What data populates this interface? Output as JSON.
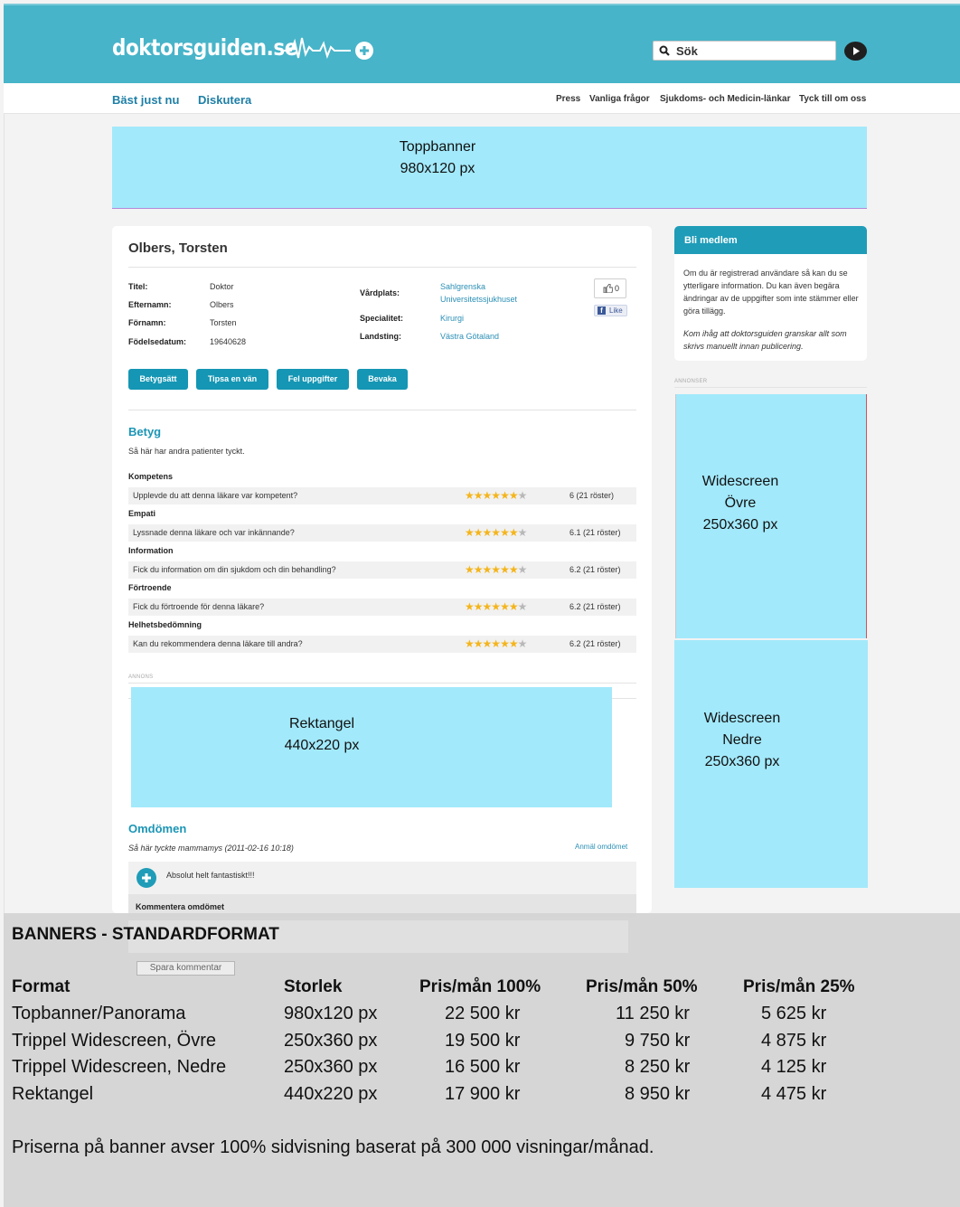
{
  "header": {
    "logo_text": "doktorsguiden.se",
    "search_placeholder": "Sök"
  },
  "subnav": {
    "left": [
      "Bäst just nu",
      "Diskutera"
    ],
    "right": [
      "Press",
      "Vanliga frågor",
      "Sjukdoms- och Medicin-länkar",
      "Tyck till om oss"
    ]
  },
  "banners": {
    "top": {
      "line1": "Toppbanner",
      "line2": "980x120 px"
    },
    "wide_top": {
      "line1": "Widescreen",
      "line2": "Övre",
      "line3": "250x360 px"
    },
    "wide_bottom": {
      "line1": "Widescreen",
      "line2": "Nedre",
      "line3": "250x360 px"
    },
    "rect": {
      "line1": "Rektangel",
      "line2": "440x220 px"
    }
  },
  "profile": {
    "name": "Olbers, Torsten",
    "fields": {
      "titel_label": "Titel:",
      "titel": "Doktor",
      "efternamn_label": "Efternamn:",
      "efternamn": "Olbers",
      "fornamn_label": "Förnamn:",
      "fornamn": "Torsten",
      "fodelsedatum_label": "Födelsedatum:",
      "fodelsedatum": "19640628",
      "vardplats_label": "Vårdplats:",
      "vardplats_1": "Sahlgrenska",
      "vardplats_2": "Universitetssjukhuset",
      "specialitet_label": "Specialitet:",
      "specialitet": "Kirurgi",
      "landsting_label": "Landsting:",
      "landsting": "Västra Götaland"
    },
    "like_count": "0",
    "like_label": "Like",
    "buttons": [
      "Betygsätt",
      "Tipsa en vän",
      "Fel uppgifter",
      "Bevaka"
    ]
  },
  "ratings": {
    "title": "Betyg",
    "subtitle": "Så här har andra patienter tyckt.",
    "items": [
      {
        "category": "Kompetens",
        "question": "Upplevde du att denna läkare var kompetent?",
        "score": "6 (21 röster)",
        "stars": 6
      },
      {
        "category": "Empati",
        "question": "Lyssnade denna läkare och var inkännande?",
        "score": "6.1 (21 röster)",
        "stars": 6
      },
      {
        "category": "Information",
        "question": "Fick du information om din sjukdom och din behandling?",
        "score": "6.2 (21 röster)",
        "stars": 6
      },
      {
        "category": "Förtroende",
        "question": "Fick du förtroende för denna läkare?",
        "score": "6.2 (21 röster)",
        "stars": 6
      },
      {
        "category": "Helhetsbedömning",
        "question": "Kan du rekommendera denna läkare till andra?",
        "score": "6.2 (21 röster)",
        "stars": 6
      }
    ]
  },
  "ad_label": "ANNONS",
  "ads_label": "ANNONSER",
  "reviews": {
    "title": "Omdömen",
    "meta": "Så här tyckte mammamys (2011-02-16 10:18)",
    "report": "Anmäl omdömet",
    "text": "Absolut helt fantastiskt!!!",
    "comment_heading": "Kommentera omdömet",
    "save_button": "Spara kommentar"
  },
  "sidebar": {
    "title": "Bli medlem",
    "text": "Om du är registrerad användare så kan du se ytterligare information. Du kan även begära ändringar av de uppgifter som inte stämmer eller göra tillägg.",
    "note": "Kom ihåg att doktorsguiden granskar allt som skrivs manuellt innan publicering."
  },
  "pricing": {
    "title": "BANNERS - STANDARDFORMAT",
    "headers": [
      "Format",
      "Storlek",
      "Pris/mån 100%",
      "Pris/mån 50%",
      "Pris/mån 25%"
    ],
    "rows": [
      [
        "Topbanner/Panorama",
        "980x120 px",
        "22 500 kr",
        "11 250 kr",
        "5 625 kr"
      ],
      [
        "Trippel Widescreen, Övre",
        "250x360 px",
        "19 500 kr",
        "9 750 kr",
        "4 875 kr"
      ],
      [
        "Trippel Widescreen, Nedre",
        "250x360 px",
        "16 500 kr",
        "8 250 kr",
        "4 125 kr"
      ],
      [
        "Rektangel",
        "440x220 px",
        "17 900 kr",
        "8 950 kr",
        "4 475 kr"
      ]
    ],
    "note": "Priserna på banner avser 100% sidvisning baserat på 300 000 visningar/månad."
  }
}
